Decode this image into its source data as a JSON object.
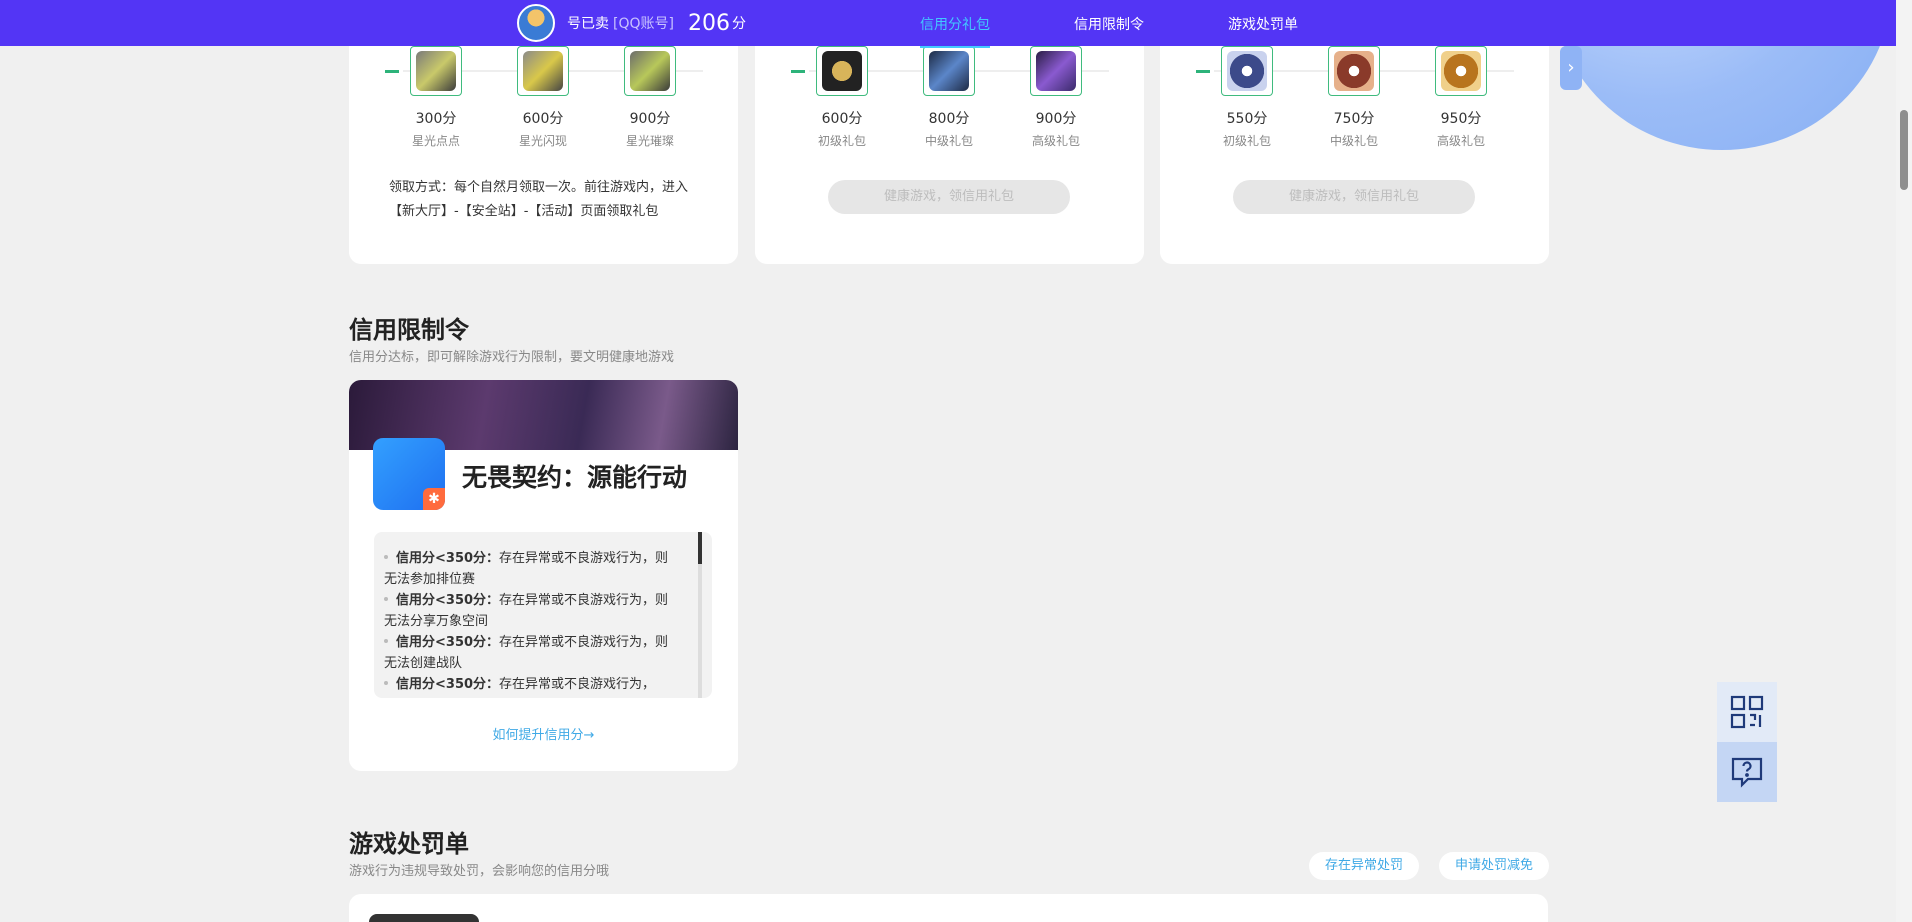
{
  "header": {
    "username": "号已卖",
    "account_type": "[QQ账号]",
    "credit_score": "206",
    "score_unit": "分",
    "tabs": [
      {
        "label": "信用分礼包",
        "active": true
      },
      {
        "label": "信用限制令",
        "active": false
      },
      {
        "label": "游戏处罚单",
        "active": false
      }
    ],
    "accent_color": "#5335f5",
    "active_tab_color": "#42c9ff"
  },
  "gift_cards": [
    {
      "items": [
        {
          "points": "300分",
          "level": "星光点点"
        },
        {
          "points": "600分",
          "level": "星光闪现"
        },
        {
          "points": "900分",
          "level": "星光璀璨"
        }
      ],
      "claim_text": "领取方式：每个自然月领取一次。前往游戏内，进入【新大厅】-【安全站】-【活动】页面领取礼包"
    },
    {
      "items": [
        {
          "points": "600分",
          "level": "初级礼包"
        },
        {
          "points": "800分",
          "level": "中级礼包"
        },
        {
          "points": "900分",
          "level": "高级礼包"
        }
      ],
      "button_label": "健康游戏，领信用礼包"
    },
    {
      "items": [
        {
          "points": "550分",
          "level": "初级礼包"
        },
        {
          "points": "750分",
          "level": "中级礼包"
        },
        {
          "points": "950分",
          "level": "高级礼包"
        }
      ],
      "button_label": "健康游戏，领信用礼包"
    }
  ],
  "next_icon": "chevron-right-icon",
  "restriction_section": {
    "title": "信用限制令",
    "subtitle": "信用分达标，即可解除游戏行为限制，要文明健康地游戏",
    "game_name": "无畏契约：源能行动",
    "rules": [
      {
        "condition": "信用分<350分：",
        "text": "存在异常或不良游戏行为，则无法参加排位赛"
      },
      {
        "condition": "信用分<350分：",
        "text": "存在异常或不良游戏行为，则无法分享万象空间"
      },
      {
        "condition": "信用分<350分：",
        "text": "存在异常或不良游戏行为，则无法创建战队"
      },
      {
        "condition": "信用分<350分：",
        "text": "存在异常或不良游戏行为，"
      }
    ],
    "how_link": "如何提升信用分→"
  },
  "penalty_section": {
    "title": "游戏处罚单",
    "subtitle": "游戏行为违规导致处罚，会影响您的信用分哦",
    "buttons": [
      "存在异常处罚",
      "申请处罚减免"
    ]
  },
  "side_float": {
    "qr_icon": "qr-code-icon",
    "help_icon": "help-chat-icon"
  }
}
